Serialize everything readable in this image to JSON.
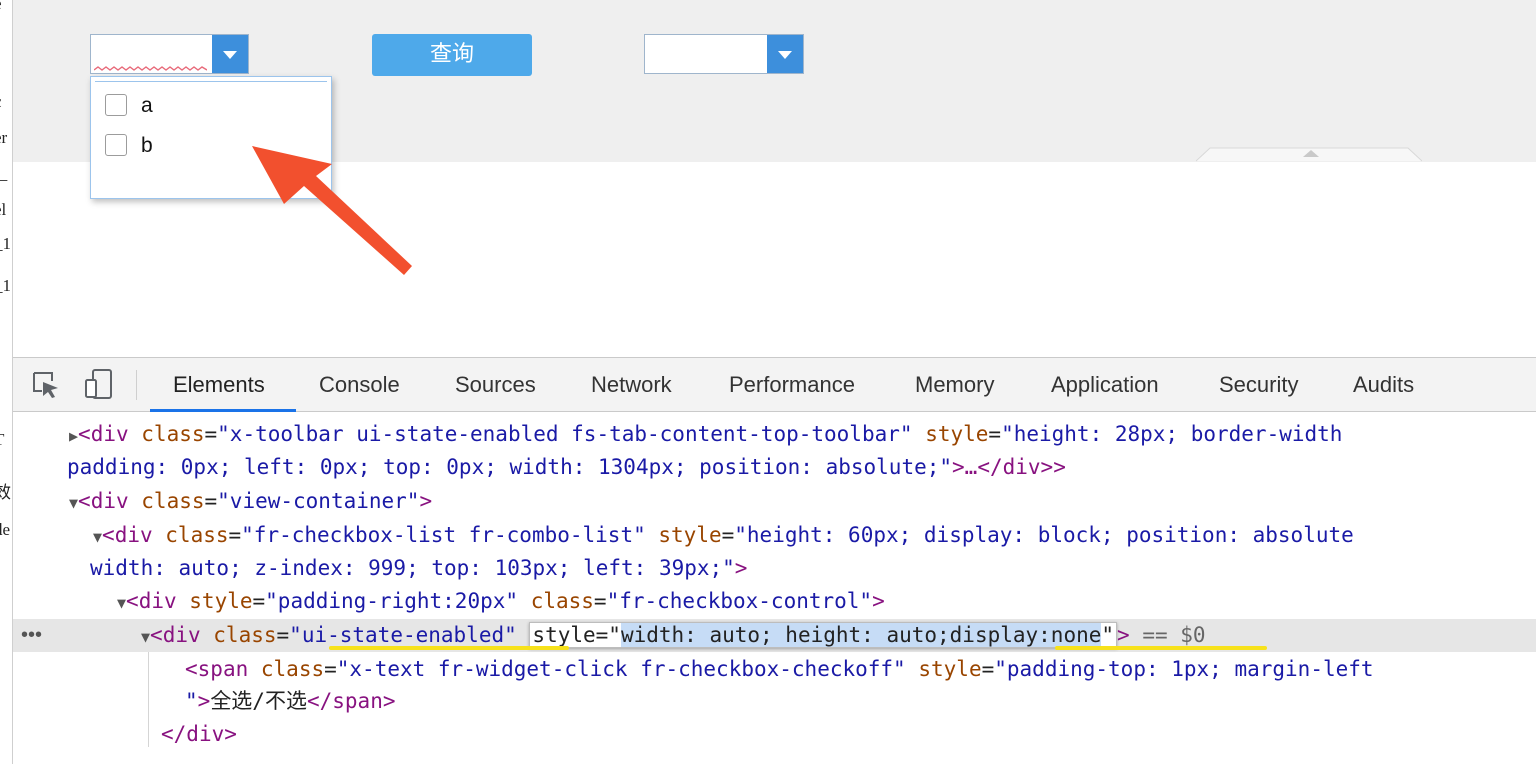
{
  "left_strip_chars": [
    "e",
    "c",
    "er",
    "i_",
    "el",
    "_1",
    "_1",
    "i",
    "T",
    "效",
    "de"
  ],
  "app": {
    "query_button_label": "查询",
    "dropdown_options": [
      {
        "label": "a",
        "checked": false
      },
      {
        "label": "b",
        "checked": false
      }
    ]
  },
  "devtools": {
    "tabs": [
      "Elements",
      "Console",
      "Sources",
      "Network",
      "Performance",
      "Memory",
      "Application",
      "Security",
      "Audits"
    ],
    "active_tab": "Elements",
    "code": {
      "l1_tag": "div",
      "l1_class_attr": "class",
      "l1_class_val": "\"x-toolbar ui-state-enabled fs-tab-content-top-toolbar\"",
      "l1_style_attr": "style",
      "l1_style_val": "\"height: 28px; border-width",
      "l2_text": "padding: 0px; left: 0px; top: 0px; width: 1304px; position: absolute;\"",
      "l2_tail": "…</div>",
      "l3_tag": "div",
      "l3_class_attr": "class",
      "l3_class_val": "\"view-container\"",
      "l4_tag": "div",
      "l4_class_attr": "class",
      "l4_class_val": "\"fr-checkbox-list fr-combo-list\"",
      "l4_style_attr": "style",
      "l4_style_val": "\"height: 60px; display: block; position: absolute",
      "l5_text": "width: auto; z-index: 999; top: 103px; left: 39px;\"",
      "l6_tag": "div",
      "l6_style_attr": "style",
      "l6_style_val": "\"padding-right:20px\"",
      "l6_class_attr": "class",
      "l6_class_val": "\"fr-checkbox-control\"",
      "l7_tag": "div",
      "l7_class_attr": "class",
      "l7_class_val_q1": "\"",
      "l7_class_val": "ui-state-enabled",
      "l7_class_val_q2": "\"",
      "l7_style_attr": "style",
      "l7_style_eq": "=\"",
      "l7_style_val_a": "width: auto; height: auto",
      "l7_style_val_b": ";display:none",
      "l7_style_q": "\"",
      "l7_dollar": "== $0",
      "l8_tag": "span",
      "l8_class_attr": "class",
      "l8_class_val": "\"x-text fr-widget-click fr-checkbox-checkoff\"",
      "l8_style_attr": "style",
      "l8_style_val": "\"padding-top: 1px; margin-left",
      "l9_text": "全选/不选",
      "l9_close": "span",
      "l10_close": "div"
    }
  }
}
